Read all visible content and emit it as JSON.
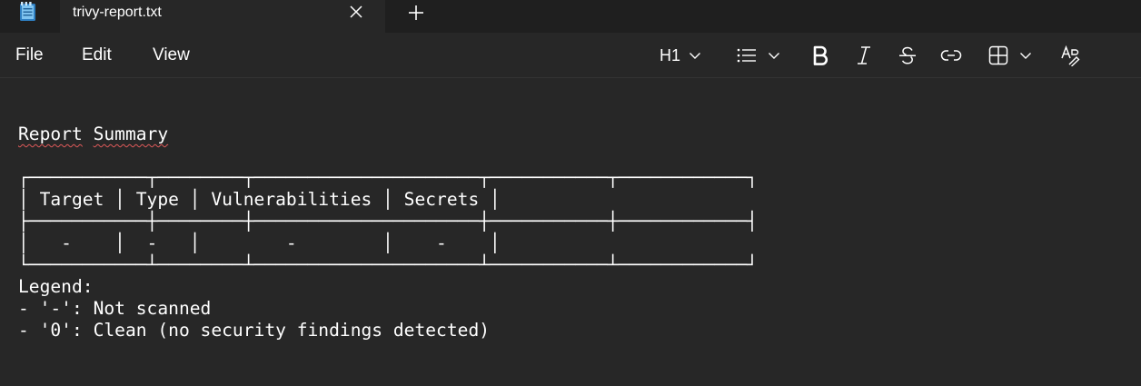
{
  "window": {
    "tab_title": "trivy-report.txt"
  },
  "menu": {
    "file": "File",
    "edit": "Edit",
    "view": "View"
  },
  "toolbar": {
    "heading_label": "H1"
  },
  "document": {
    "title_word1": "Report",
    "title_word2": "Summary",
    "lines": [
      "┌───────────┬────────┬─────────────────────┬───────────┬────────────┐",
      "│ Target │ Type │ Vulnerabilities │ Secrets │",
      "├───────────┼────────┼─────────────────────┼───────────┼────────────┤",
      "│   -    │  -   │        -        │    -    │",
      "└───────────┴────────┴─────────────────────┴───────────┴────────────┘",
      "Legend:",
      "- '-': Not scanned",
      "- '0': Clean (no security findings detected)"
    ]
  },
  "colors": {
    "background": "#272727",
    "tabbar": "#1f1f1f",
    "text": "#ffffff",
    "app_icon": "#4aa3df",
    "spellcheck": "#e05a5a"
  }
}
